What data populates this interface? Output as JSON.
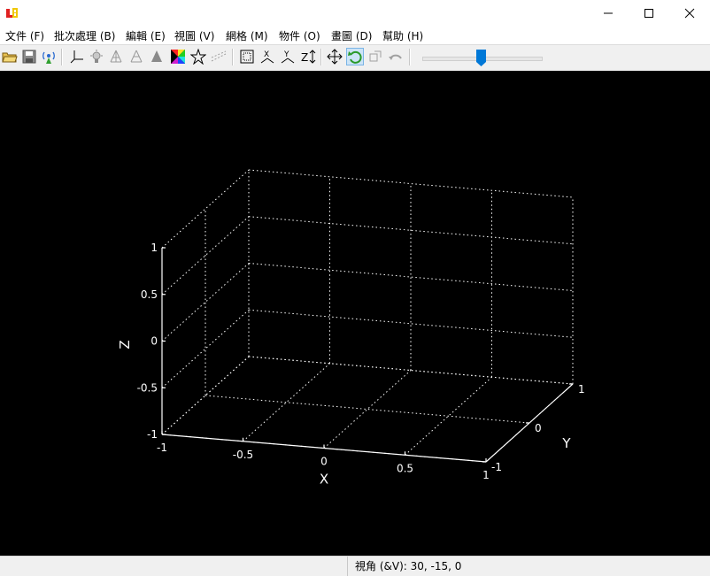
{
  "window": {
    "minimize_glyph": "—",
    "maximize_glyph": "☐",
    "close_glyph": "✕"
  },
  "menu": [
    "文件 (F)",
    "批次處理 (B)",
    "編輯 (E)",
    "視圖 (V)",
    "網格 (M)",
    "物件 (O)",
    "畫圖 (D)",
    "幫助 (H)"
  ],
  "toolbar": {
    "icons": [
      "open-folder-icon",
      "save-icon",
      "wireless-icon",
      "axes-icon",
      "light-icon",
      "wire-cone-icon",
      "wire-cone-2-icon",
      "solid-cone-icon",
      "color-square-icon",
      "star-icon",
      "dots-icon",
      "bounding-box-icon",
      "x-axis-icon",
      "y-axis-icon",
      "z-axis-icon",
      "move-icon",
      "rotate-icon",
      "zoom-icon",
      "undo-icon"
    ],
    "active": "rotate-icon",
    "slider_level": 0.49
  },
  "plot": {
    "x_ticks": [
      "-1",
      "-0.5",
      "0",
      "0.5",
      "1"
    ],
    "y_ticks": [
      "-1",
      "0",
      "1"
    ],
    "z_ticks": [
      "1",
      "0.5",
      "0",
      "-0.5",
      "-1"
    ],
    "x_title": "X",
    "y_title": "Y",
    "z_title": "Z",
    "xlim": [
      -1,
      1
    ],
    "ylim": [
      -1,
      1
    ],
    "zlim": [
      -1,
      1
    ],
    "grid": true,
    "background": "#000000",
    "axis_color": "#ffffff"
  },
  "status": {
    "view_angle": "視角 (&V): 30, -15, 0"
  }
}
